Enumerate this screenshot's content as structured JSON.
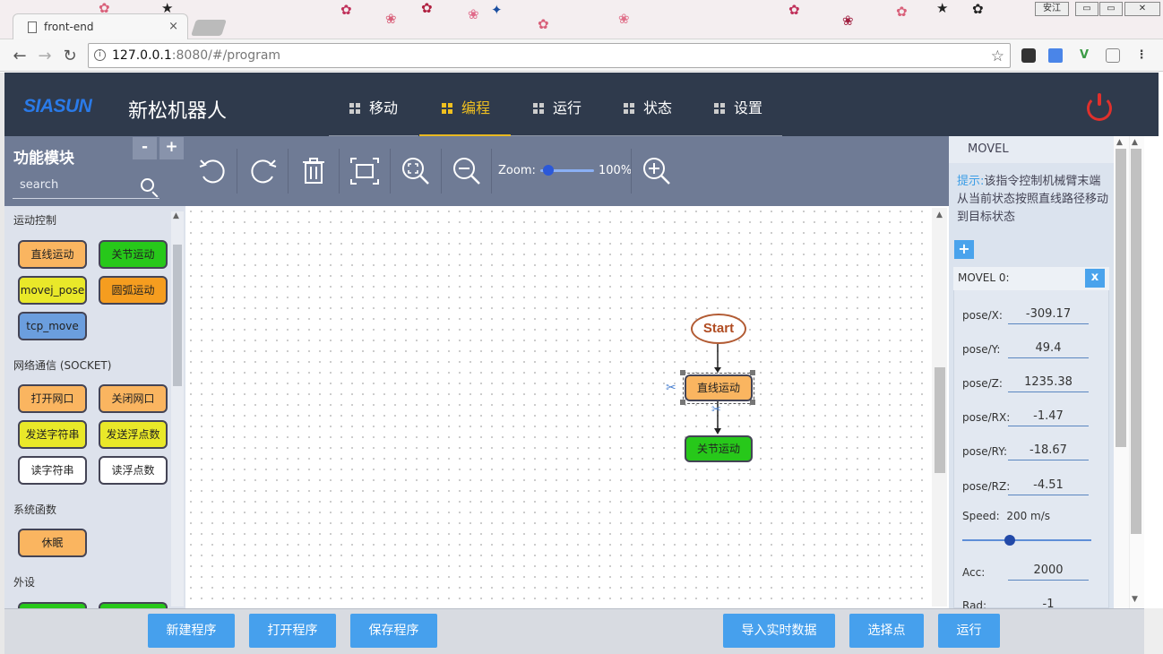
{
  "browser": {
    "tab_title": "front-end",
    "tab_close": "×",
    "url_host": "127.0.0.1",
    "url_rest": ":8080/#/program",
    "info_glyph": "i",
    "bookmark_glyph": "☆",
    "window_badge": "安江",
    "win_min": "▭",
    "win_max": "▭",
    "win_close": "✕"
  },
  "app": {
    "logo_text": "SIASUN",
    "brand": "新松机器人",
    "nav": [
      {
        "label": "移动",
        "active": false
      },
      {
        "label": "编程",
        "active": true
      },
      {
        "label": "运行",
        "active": false
      },
      {
        "label": "状态",
        "active": false
      },
      {
        "label": "设置",
        "active": false
      }
    ],
    "accent_color": "#46a0ed",
    "header_color": "#2f3a4c",
    "active_nav_color": "#f0c020"
  },
  "left_panel": {
    "title": "功能模块",
    "minus": "-",
    "plus": "+",
    "search_placeholder": "search",
    "categories": [
      {
        "label": "运动控制",
        "blocks": [
          "直线运动",
          "关节运动",
          "movej_pose",
          "圆弧运动",
          "tcp_move"
        ]
      },
      {
        "label": "网络通信",
        "label_suffix": "(SOCKET)",
        "blocks": [
          "打开网口",
          "关闭网口",
          "发送字符串",
          "发送浮点数",
          "读字符串",
          "读浮点数"
        ]
      },
      {
        "label": "系统函数",
        "blocks": [
          "休眠"
        ]
      },
      {
        "label": "外设",
        "blocks": []
      }
    ]
  },
  "toolbar": {
    "zoom_label": "Zoom:",
    "zoom_percent": "100%",
    "zoom_level": 0.15,
    "icons": [
      "undo-icon",
      "redo-icon",
      "trash-icon",
      "fit-screen-icon",
      "zoom-fit-icon",
      "zoom-out-icon",
      "zoom-in-icon"
    ]
  },
  "canvas": {
    "start_label": "Start",
    "node1_label": "直线运动",
    "node2_label": "关节运动"
  },
  "right_panel": {
    "header": "MOVEL",
    "hint_label": "提示:",
    "hint_text": "该指令控制机械臂末端从当前状态按照直线路径移动到目标状态",
    "add_glyph": "+",
    "card_title": "MOVEL 0:",
    "close_glyph": "x",
    "params": [
      {
        "label": "pose/X:",
        "value": "-309.17"
      },
      {
        "label": "pose/Y:",
        "value": "49.4"
      },
      {
        "label": "pose/Z:",
        "value": "1235.38"
      },
      {
        "label": "pose/RX:",
        "value": "-1.47"
      },
      {
        "label": "pose/RY:",
        "value": "-18.67"
      },
      {
        "label": "pose/RZ:",
        "value": "-4.51"
      }
    ],
    "speed_label": "Speed:",
    "speed_value": "200 m/s",
    "speed_level": 0.37,
    "acc_label": "Acc:",
    "acc_value": "2000",
    "rad_label": "Rad:",
    "rad_value": "-1"
  },
  "bottom_buttons": {
    "new_program": "新建程序",
    "open_program": "打开程序",
    "save_program": "保存程序",
    "import_realtime": "导入实时数据",
    "select_point": "选择点",
    "run": "运行"
  }
}
